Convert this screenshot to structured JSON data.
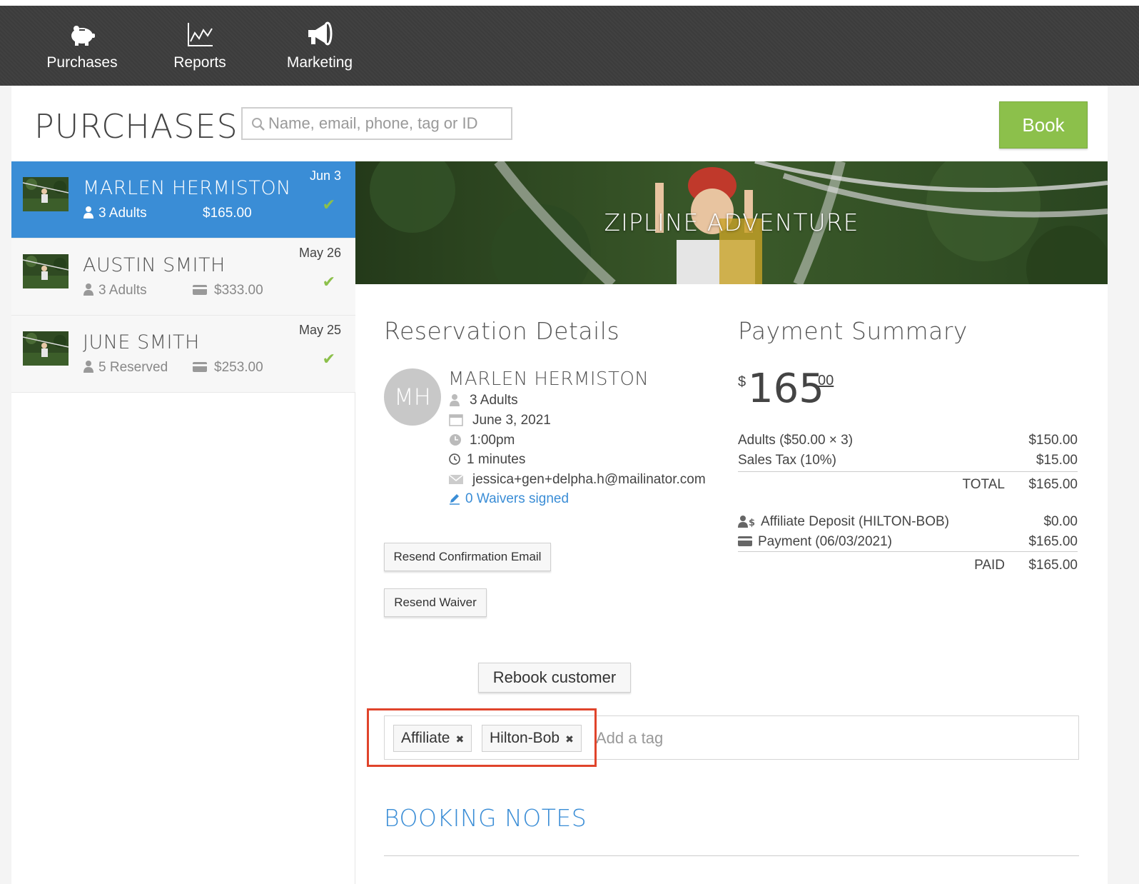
{
  "nav": {
    "items": [
      {
        "label": "Purchases",
        "icon": "piggy-bank-icon"
      },
      {
        "label": "Reports",
        "icon": "line-chart-icon"
      },
      {
        "label": "Marketing",
        "icon": "megaphone-icon"
      }
    ]
  },
  "header": {
    "title": "PURCHASES",
    "search_placeholder": "Name, email, phone, tag or ID",
    "book_label": "Book"
  },
  "purchases": [
    {
      "name": "MARLEN HERMISTON",
      "date": "Jun 3",
      "qty": "3 Adults",
      "amount": "$165.00",
      "active": true,
      "check": "✔"
    },
    {
      "name": "AUSTIN SMITH",
      "date": "May 26",
      "qty": "3 Adults",
      "amount": "$333.00",
      "active": false,
      "check": "✔"
    },
    {
      "name": "JUNE SMITH",
      "date": "May 25",
      "qty": "5 Reserved",
      "amount": "$253.00",
      "active": false,
      "check": "✔"
    }
  ],
  "detail": {
    "hero_title": "ZIPLINE ADVENTURE",
    "reservation": {
      "heading": "Reservation Details",
      "initials": "MH",
      "name": "MARLEN HERMISTON",
      "qty": "3 Adults",
      "date": "June 3, 2021",
      "time": "1:00pm",
      "duration": "1 minutes",
      "email": "jessica+gen+delpha.h@mailinator.com",
      "waivers": "0 Waivers signed"
    },
    "buttons": {
      "resend_confirmation": "Resend Confirmation Email",
      "resend_waiver": "Resend Waiver",
      "rebook": "Rebook customer"
    },
    "payment": {
      "heading": "Payment Summary",
      "currency": "$",
      "amount_whole": "165",
      "amount_cents": "00",
      "lines": [
        {
          "label": "Adults ($50.00 × 3)",
          "value": "$150.00"
        },
        {
          "label": "Sales Tax (10%)",
          "value": "$15.00"
        }
      ],
      "total_label": "TOTAL",
      "total_value": "$165.00",
      "deposit_label": "Affiliate Deposit (HILTON-BOB)",
      "deposit_value": "$0.00",
      "payment_label": "Payment (06/03/2021)",
      "payment_value": "$165.00",
      "paid_label": "PAID",
      "paid_value": "$165.00"
    },
    "tags": {
      "items": [
        "Affiliate",
        "Hilton-Bob"
      ],
      "remove_glyph": "✖",
      "placeholder": "Add a tag"
    },
    "notes_heading": "BOOKING NOTES"
  },
  "colors": {
    "accent": "#3a8dd6",
    "book_green": "#8cc04b",
    "nav_bg": "#3d3d3d",
    "highlight": "#e0442b"
  }
}
